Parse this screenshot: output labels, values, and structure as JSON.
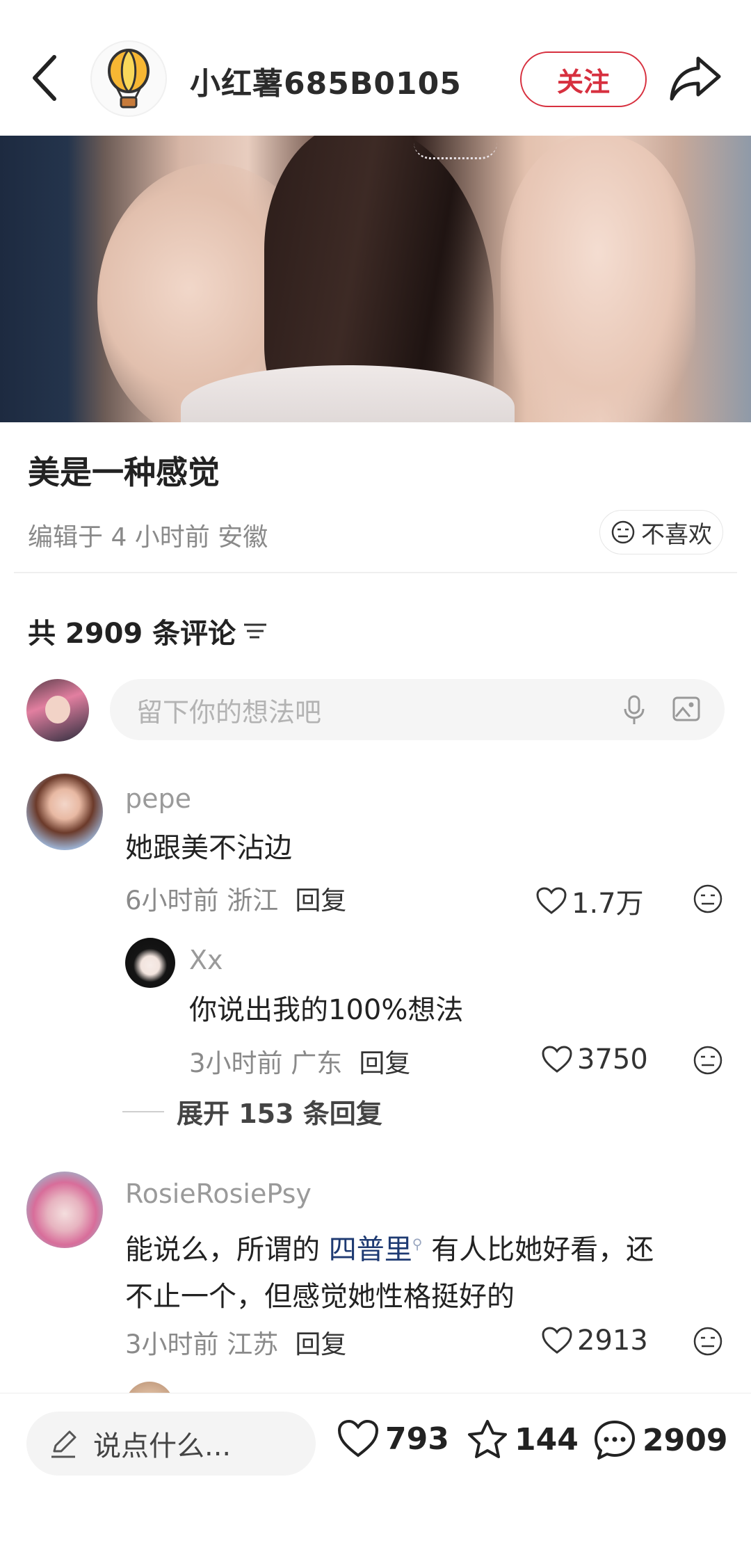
{
  "header": {
    "username": "小红薯685B0105",
    "follow_label": "关注"
  },
  "post": {
    "title": "美是一种感觉",
    "meta": "编辑于 4 小时前 安徽",
    "dislike_label": "不喜欢",
    "comment_count_label": "共 2909 条评论"
  },
  "comment_input": {
    "placeholder": "留下你的想法吧"
  },
  "comments": [
    {
      "name": "pepe",
      "text": "她跟美不沾边",
      "time_location": "6小时前 浙江",
      "reply_label": "回复",
      "likes": "1.7万"
    },
    {
      "name": "Xx",
      "text": "你说出我的100%想法",
      "time_location": "3小时前 广东",
      "reply_label": "回复",
      "likes": "3750"
    },
    {
      "name": "RosieRosiePsy",
      "text_before": "能说么，所谓的 ",
      "topic": "四普里",
      "text_after": " 有人比她好看，还",
      "text_line2": "不止一个，但感觉她性格挺好的",
      "time_location": "3小时前 江苏",
      "reply_label": "回复",
      "likes": "2913"
    }
  ],
  "expand_label": "展开 153 条回复",
  "bottom_bar": {
    "say_placeholder": "说点什么...",
    "likes": "793",
    "favorites": "144",
    "comments": "2909"
  },
  "colors": {
    "accent_red": "#d7303f",
    "topic_blue": "#1e3a72"
  }
}
